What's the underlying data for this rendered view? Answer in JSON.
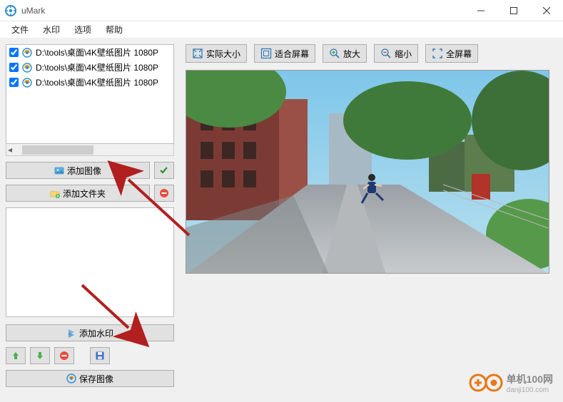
{
  "window": {
    "title": "uMark"
  },
  "menu": {
    "file": "文件",
    "watermark": "水印",
    "options": "选项",
    "help": "帮助"
  },
  "files": {
    "items": [
      {
        "path": "D:\\tools\\桌面\\4K壁纸图片 1080P"
      },
      {
        "path": "D:\\tools\\桌面\\4K壁纸图片 1080P"
      },
      {
        "path": "D:\\tools\\桌面\\4K壁纸图片 1080P"
      }
    ]
  },
  "buttons": {
    "add_image": "添加图像",
    "add_folder": "添加文件夹",
    "add_watermark": "添加水印",
    "save_image": "保存图像"
  },
  "toolbar": {
    "actual_size": "实际大小",
    "fit_screen": "适合屏幕",
    "zoom_in": "放大",
    "zoom_out": "缩小",
    "fullscreen": "全屏幕"
  },
  "branding": {
    "cn": "单机100网",
    "en": "danji100.com"
  }
}
